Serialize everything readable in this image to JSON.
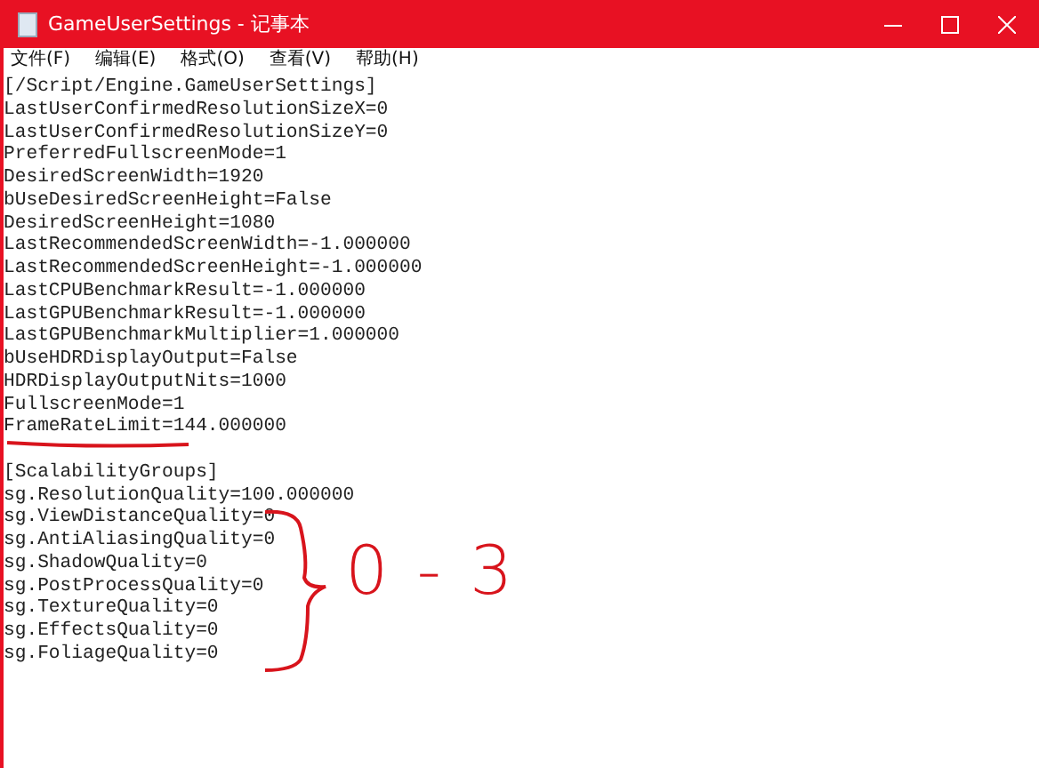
{
  "window": {
    "title": "GameUserSettings - 记事本"
  },
  "menu": [
    "文件(F)",
    "编辑(E)",
    "格式(O)",
    "查看(V)",
    "帮助(H)"
  ],
  "sections": [
    {
      "lines": [
        "[/Script/Engine.GameUserSettings]",
        "LastUserConfirmedResolutionSizeX=0",
        "LastUserConfirmedResolutionSizeY=0",
        "PreferredFullscreenMode=1",
        "DesiredScreenWidth=1920",
        "bUseDesiredScreenHeight=False",
        "DesiredScreenHeight=1080",
        "LastRecommendedScreenWidth=-1.000000",
        "LastRecommendedScreenHeight=-1.000000",
        "LastCPUBenchmarkResult=-1.000000",
        "LastGPUBenchmarkResult=-1.000000",
        "LastGPUBenchmarkMultiplier=1.000000",
        "bUseHDRDisplayOutput=False",
        "HDRDisplayOutputNits=1000",
        "FullscreenMode=1",
        "FrameRateLimit=144.000000"
      ]
    },
    {
      "lines": [
        "[ScalabilityGroups]",
        "sg.ResolutionQuality=100.000000",
        "sg.ViewDistanceQuality=0",
        "sg.AntiAliasingQuality=0",
        "sg.ShadowQuality=0",
        "sg.PostProcessQuality=0",
        "sg.TextureQuality=0",
        "sg.EffectsQuality=0",
        "sg.FoliageQuality=0"
      ]
    }
  ],
  "annotation": {
    "label": "0 - 3"
  }
}
